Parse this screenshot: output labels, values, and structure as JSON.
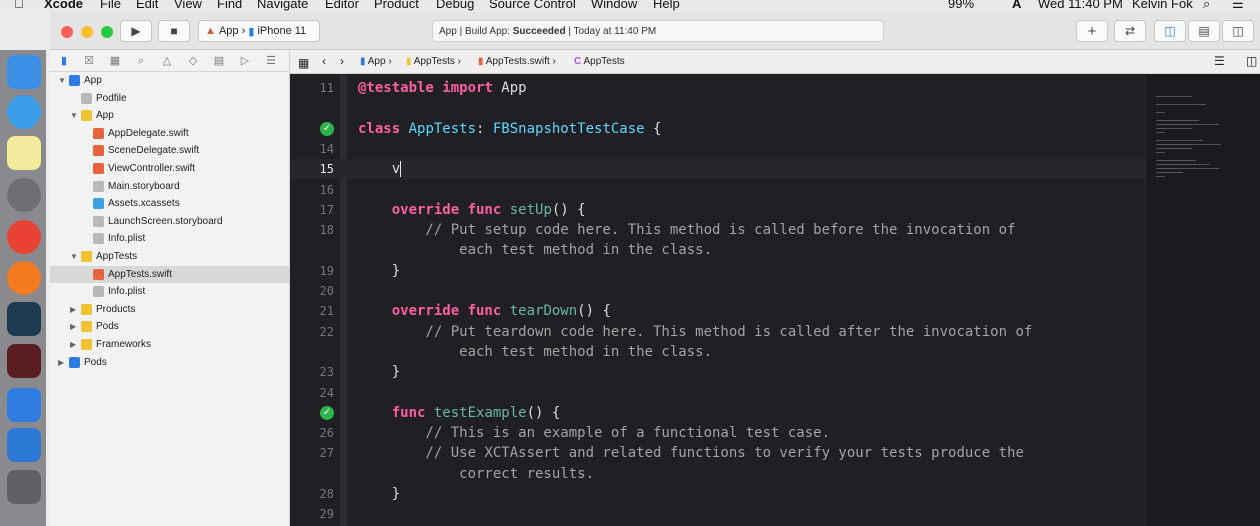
{
  "menubar": {
    "app": "Xcode",
    "items": [
      "File",
      "Edit",
      "View",
      "Find",
      "Navigate",
      "Editor",
      "Product",
      "Debug",
      "Source Control",
      "Window",
      "Help"
    ],
    "battery": "99%",
    "input": "A",
    "clock": "Wed 11:40 PM",
    "user": "Kelvin Fok"
  },
  "toolbar": {
    "scheme_target": "App",
    "scheme_device": "iPhone 11",
    "status_prefix": "App | Build App:",
    "status_result": "Succeeded",
    "status_time": "| Today at 11:40 PM",
    "add_label": "+",
    "swap_label": "⇄"
  },
  "navigator": {
    "tree": [
      {
        "label": "App",
        "depth": 0,
        "kind": "project",
        "disclosure": "open"
      },
      {
        "label": "Podfile",
        "depth": 1,
        "kind": "file"
      },
      {
        "label": "App",
        "depth": 1,
        "kind": "folder",
        "disclosure": "open"
      },
      {
        "label": "AppDelegate.swift",
        "depth": 2,
        "kind": "swift"
      },
      {
        "label": "SceneDelegate.swift",
        "depth": 2,
        "kind": "swift"
      },
      {
        "label": "ViewController.swift",
        "depth": 2,
        "kind": "swift"
      },
      {
        "label": "Main.storyboard",
        "depth": 2,
        "kind": "file"
      },
      {
        "label": "Assets.xcassets",
        "depth": 2,
        "kind": "assets"
      },
      {
        "label": "LaunchScreen.storyboard",
        "depth": 2,
        "kind": "file"
      },
      {
        "label": "Info.plist",
        "depth": 2,
        "kind": "file"
      },
      {
        "label": "AppTests",
        "depth": 1,
        "kind": "folder",
        "disclosure": "open"
      },
      {
        "label": "AppTests.swift",
        "depth": 2,
        "kind": "swift",
        "selected": true
      },
      {
        "label": "Info.plist",
        "depth": 2,
        "kind": "file"
      },
      {
        "label": "Products",
        "depth": 1,
        "kind": "folder",
        "disclosure": "closed"
      },
      {
        "label": "Pods",
        "depth": 1,
        "kind": "folder",
        "disclosure": "closed"
      },
      {
        "label": "Frameworks",
        "depth": 1,
        "kind": "folder",
        "disclosure": "closed"
      },
      {
        "label": "Pods",
        "depth": 0,
        "kind": "project",
        "disclosure": "closed"
      }
    ]
  },
  "jumpbar": {
    "crumbs": [
      "App",
      "AppTests",
      "AppTests.swift",
      "AppTests"
    ]
  },
  "editor": {
    "current_line": "15",
    "lines": [
      {
        "n": "11",
        "tokens": [
          [
            "kw",
            "@testable import"
          ],
          [
            "plain",
            " App"
          ]
        ]
      },
      {
        "n": "",
        "tokens": [],
        "test": true
      },
      {
        "n": "",
        "tokens": [
          [
            "kw",
            "class"
          ],
          [
            "ty",
            " AppTests"
          ],
          [
            "plain",
            ": "
          ],
          [
            "ty",
            "FBSnapshotTestCase"
          ],
          [
            "plain",
            " {"
          ]
        ]
      },
      {
        "n": "14",
        "tokens": []
      },
      {
        "n": "15",
        "tokens": [
          [
            "plain",
            "    v"
          ]
        ],
        "cursor": true
      },
      {
        "n": "16",
        "tokens": []
      },
      {
        "n": "17",
        "tokens": [
          [
            "kw",
            "    override func"
          ],
          [
            "fn",
            " setUp"
          ],
          [
            "plain",
            "() {"
          ]
        ]
      },
      {
        "n": "18",
        "tokens": [
          [
            "cm",
            "        // Put setup code here. This method is called before the invocation of"
          ]
        ]
      },
      {
        "n": "",
        "tokens": [
          [
            "cm",
            "            each test method in the class."
          ]
        ]
      },
      {
        "n": "19",
        "tokens": [
          [
            "plain",
            "    }"
          ]
        ]
      },
      {
        "n": "20",
        "tokens": []
      },
      {
        "n": "21",
        "tokens": [
          [
            "kw",
            "    override func"
          ],
          [
            "fn",
            " tearDown"
          ],
          [
            "plain",
            "() {"
          ]
        ]
      },
      {
        "n": "22",
        "tokens": [
          [
            "cm",
            "        // Put teardown code here. This method is called after the invocation of"
          ]
        ]
      },
      {
        "n": "",
        "tokens": [
          [
            "cm",
            "            each test method in the class."
          ]
        ]
      },
      {
        "n": "23",
        "tokens": [
          [
            "plain",
            "    }"
          ]
        ]
      },
      {
        "n": "24",
        "tokens": []
      },
      {
        "n": "",
        "tokens": [
          [
            "kw",
            "    func"
          ],
          [
            "fn",
            " testExample"
          ],
          [
            "plain",
            "() {"
          ]
        ]
      },
      {
        "n": "26",
        "tokens": [
          [
            "cm",
            "        // This is an example of a functional test case."
          ]
        ]
      },
      {
        "n": "27",
        "tokens": [
          [
            "cm",
            "        // Use XCTAssert and related functions to verify your tests produce the"
          ]
        ]
      },
      {
        "n": "",
        "tokens": [
          [
            "cm",
            "            correct results."
          ]
        ]
      },
      {
        "n": "28",
        "tokens": [
          [
            "plain",
            "    }"
          ]
        ]
      },
      {
        "n": "29",
        "tokens": []
      }
    ]
  },
  "colors": {
    "keyword": "#fc5fa3",
    "type": "#5dd8ff",
    "function": "#67b7a4",
    "comment": "#a3a3a3",
    "test_passed": "#2db34a",
    "selection_accent": "#2a7be4"
  },
  "icons": {
    "test_passed": "checkmark-diamond-icon"
  }
}
